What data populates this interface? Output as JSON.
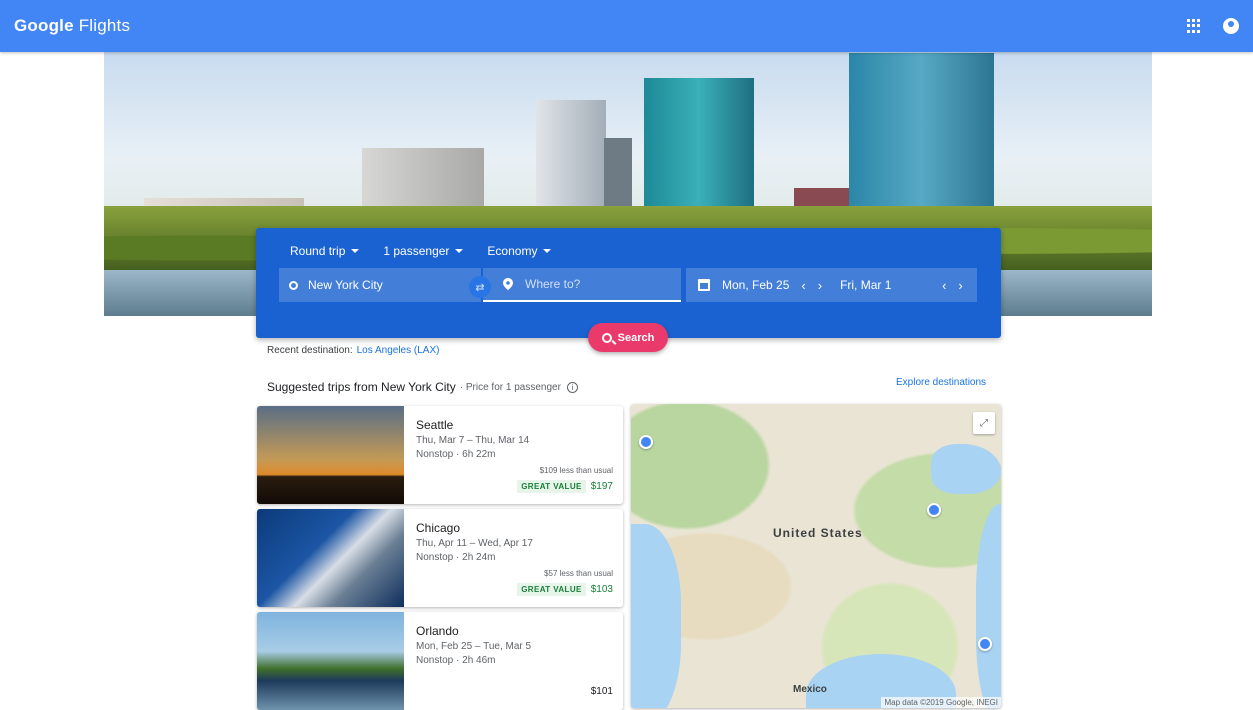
{
  "app": {
    "brand_google": "Google",
    "brand_product": "Flights"
  },
  "header_icons": [
    "apps-icon",
    "account-icon"
  ],
  "search": {
    "trip_type": "Round trip",
    "passengers": "1 passenger",
    "cabin": "Economy",
    "origin": "New York City",
    "destination_placeholder": "Where to?",
    "depart_date": "Mon, Feb 25",
    "return_date": "Fri, Mar 1",
    "search_label": "Search"
  },
  "recent": {
    "label": "Recent destination:",
    "link": "Los Angeles (LAX)"
  },
  "suggested": {
    "title": "Suggested trips from New York City",
    "subtitle": "· Price for 1 passenger",
    "explore_label": "Explore destinations",
    "trips": [
      {
        "city": "Seattle",
        "dates": "Thu, Mar 7 – Thu, Mar 14",
        "duration": "Nonstop · 6h 22m",
        "savings": "$109 less than usual",
        "badge": "GREAT VALUE",
        "price": "$197"
      },
      {
        "city": "Chicago",
        "dates": "Thu, Apr 11 – Wed, Apr 17",
        "duration": "Nonstop · 2h 24m",
        "savings": "$57 less than usual",
        "badge": "GREAT VALUE",
        "price": "$103"
      },
      {
        "city": "Orlando",
        "dates": "Mon, Feb 25 – Tue, Mar 5",
        "duration": "Nonstop · 2h 46m",
        "savings": "",
        "badge": "",
        "price": "$101"
      }
    ]
  },
  "map": {
    "country_label": "United States",
    "mexico_label": "Mexico",
    "credit": "Map data ©2019 Google, INEGI"
  },
  "colors": {
    "header": "#4285f4",
    "panel": "#1a62d1",
    "search_button": "#ea3a6c",
    "great_value": "#188038",
    "link": "#1a73e8"
  }
}
